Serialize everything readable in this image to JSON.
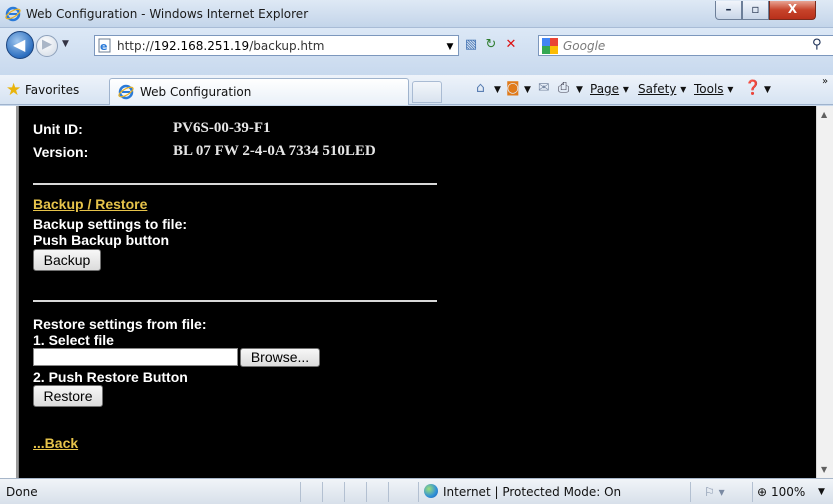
{
  "window": {
    "title": "Web Configuration - Windows Internet Explorer",
    "buttons": {
      "minimize": "–",
      "maximize": "▫",
      "close": "X"
    }
  },
  "addressbar": {
    "url_prefix": "http://",
    "url_host": "192.168.251.19",
    "url_path": "/backup.htm",
    "search_placeholder": "Google"
  },
  "favorites_bar": {
    "favorites_label": "Favorites",
    "tab_label": "Web Configuration",
    "commands": [
      "Page",
      "Safety",
      "Tools"
    ]
  },
  "page": {
    "unit_id_label": "Unit ID:",
    "unit_id_value": "PV6S-00-39-F1",
    "version_label": "Version:",
    "version_value": "BL 07 FW 2-4-0A 7334 510LED",
    "section_link": "Backup / Restore",
    "backup_text_1": "Backup settings to file:",
    "backup_text_2": "Push Backup button",
    "backup_button": "Backup",
    "restore_text_1": "Restore settings from file:",
    "restore_step_1": "1. Select file",
    "browse_button": "Browse...",
    "restore_step_2": "2. Push Restore Button",
    "restore_button": "Restore",
    "back_link": "...Back"
  },
  "statusbar": {
    "status": "Done",
    "zone": "Internet | Protected Mode: On",
    "zoom": "100%"
  },
  "colors": {
    "page_background": "#000000",
    "link": "#e6c34a",
    "text": "#ffffff"
  }
}
